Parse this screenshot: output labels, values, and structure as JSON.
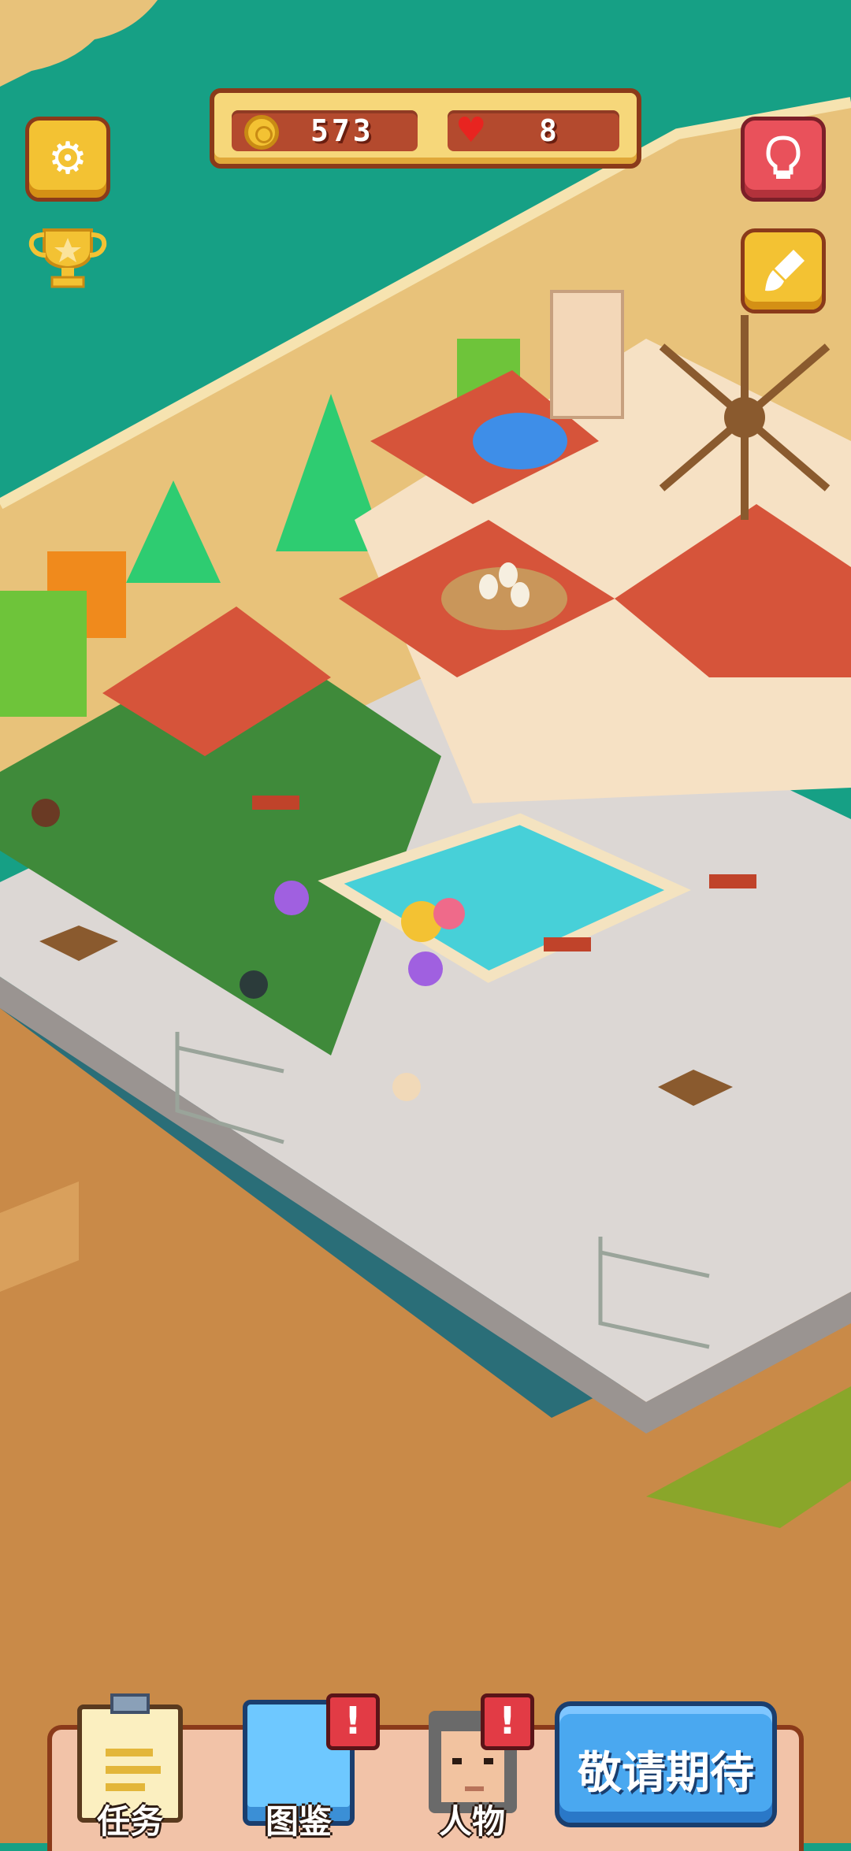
{
  "hud": {
    "coins": "573",
    "hearts": "8"
  },
  "icons": {
    "settings": "gear-icon",
    "achievements": "trophy-icon",
    "hint": "lightbulb-icon",
    "decorate": "paintbrush-icon",
    "coin": "coin-icon",
    "heart": "heart-icon"
  },
  "bottom_nav": {
    "tasks_label": "任务",
    "codex_label": "图鉴",
    "characters_label": "人物",
    "coming_soon_label": "敬请期待",
    "codex_alert": "!",
    "characters_alert": "!"
  },
  "colors": {
    "sea": "#16a085",
    "sand": "#e8c27a",
    "accent_gold": "#f3c233",
    "accent_red": "#e9515b",
    "button_blue": "#4aa8f0"
  }
}
